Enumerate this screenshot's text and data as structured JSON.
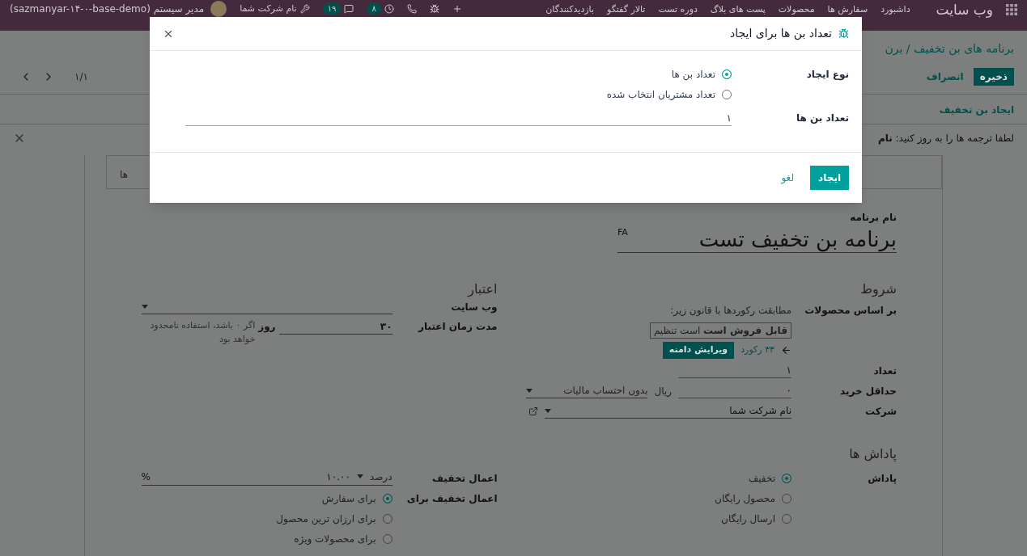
{
  "navbar": {
    "app_name": "وب سایت",
    "menu": [
      "داشبورد",
      "سفارش ها",
      "محصولات",
      "پست های بلاگ",
      "دوره تست",
      "تالار گفتگو",
      "بازدیدکنندگان"
    ],
    "systray": {
      "activity_count": "۸",
      "chat_count": "۱۹",
      "company": "نام شرکت شما",
      "user": "مدیر سیستم (sazmanyar-۱۴-۰-base-demo)"
    }
  },
  "breadcrumb": "برنامه های بن تخفیف / برن",
  "buttons": {
    "save": "ذخیره",
    "discard": "انصراف"
  },
  "pager": "۱/۱",
  "action_button": "ایجاد بن تخفیف",
  "alert": "لطفا ترجمه ها را به روز کنید: **نام**",
  "form": {
    "smart_button": "ها",
    "name_label": "نام برنامه",
    "name": "برنامه بن تخفیف تست",
    "lang": "FA",
    "conditions": {
      "title": "شروط",
      "products_label": "بر اساس محصولات",
      "rule_text": "مطابقت رکوردها با قانون زیر:",
      "rule_chip": "**قابل فروش است** است تنظیم",
      "records": "۳۳ رکورد",
      "edit_domain": "ویرایش دامنه",
      "quantity_label": "تعداد",
      "quantity": "۱",
      "min_label": "حداقل خرید",
      "min": "۰",
      "currency": "ریال",
      "tax_mode": "بدون احتساب مالیات",
      "company_label": "شرکت",
      "company": "نام شرکت شما"
    },
    "validity": {
      "title": "اعتبار",
      "website_label": "وب سایت",
      "duration_label": "مدت زمان اعتبار",
      "duration": "۳۰",
      "unit": "روز",
      "hint": "اگر ۰ باشد، استفاده نامحدود خواهد بود"
    },
    "rewards": {
      "title": "پاداش ها",
      "reward_label": "پاداش",
      "reward_options": [
        {
          "label": "تخفیف",
          "selected": true
        },
        {
          "label": "محصول رایگان",
          "selected": false
        },
        {
          "label": "ارسال رایگان",
          "selected": false
        }
      ],
      "discount_label": "اعمال تخفیف",
      "discount_type": "درصد",
      "discount_value": "۱۰.۰۰",
      "percent": "%",
      "apply_label": "اعمال تخفیف برای",
      "apply_options": [
        {
          "label": "برای سفارش",
          "selected": true
        },
        {
          "label": "برای ارزان ترین محصول",
          "selected": false
        },
        {
          "label": "برای محصولات ویژه",
          "selected": false
        }
      ]
    }
  },
  "dialog": {
    "title": "تعداد بن ها برای ایجاد",
    "type_label": "نوع ایجاد",
    "type_options": [
      {
        "label": "تعداد بن ها",
        "selected": true
      },
      {
        "label": "تعداد مشتریان انتخاب شده",
        "selected": false
      }
    ],
    "count_label": "تعداد بن ها",
    "count": "۱",
    "create": "ایجاد",
    "cancel": "لغو"
  }
}
